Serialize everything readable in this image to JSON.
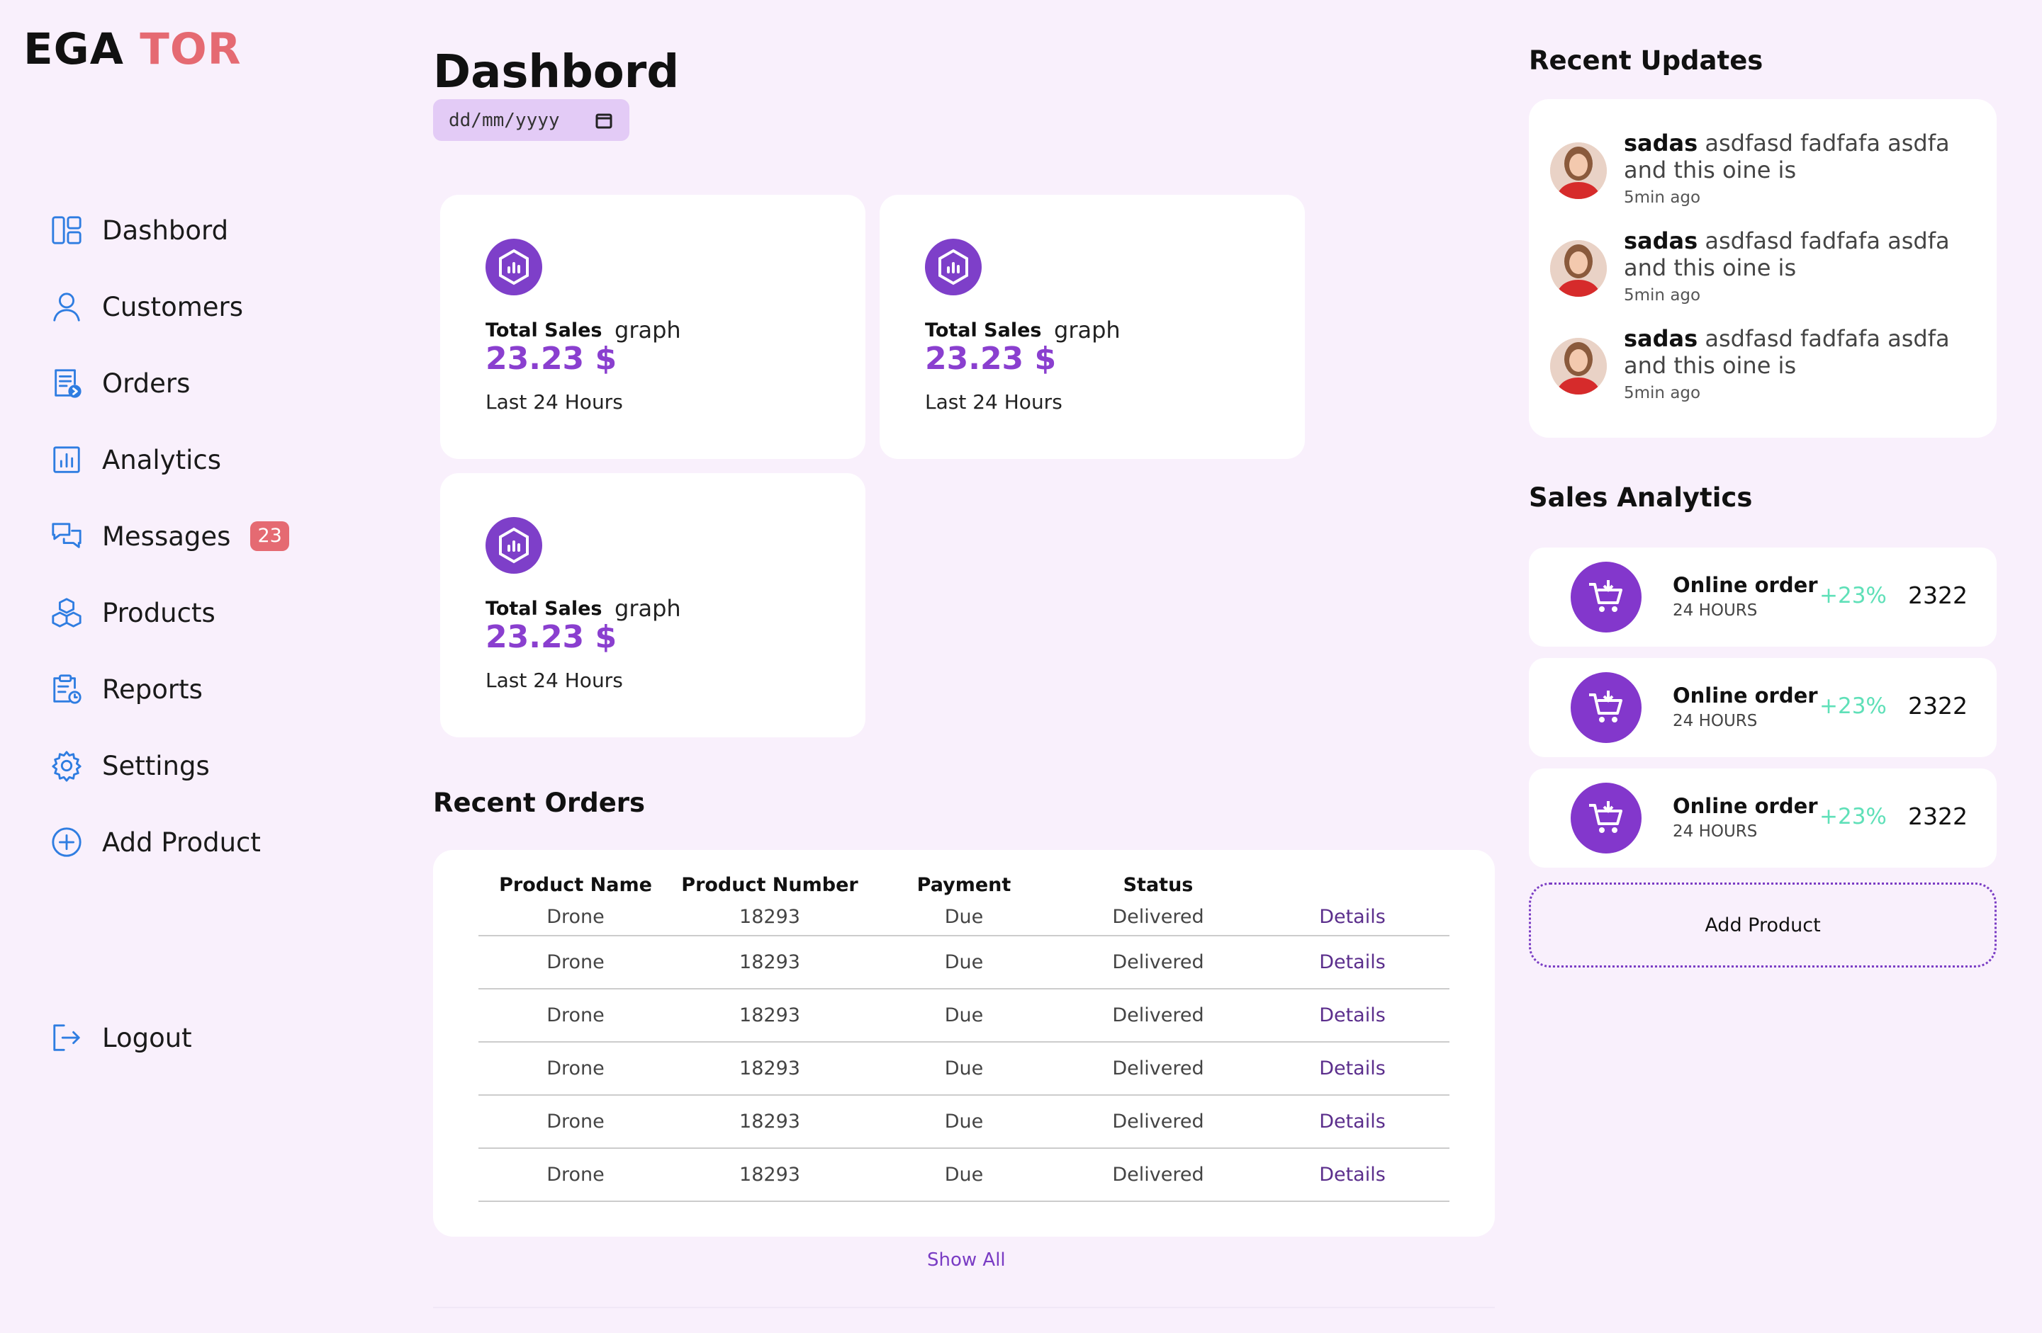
{
  "logo": {
    "part1": "EGA",
    "part2": "TOR"
  },
  "sidebar": {
    "items": [
      {
        "label": "Dashbord",
        "icon": "dashboard-icon"
      },
      {
        "label": "Customers",
        "icon": "user-icon"
      },
      {
        "label": "Orders",
        "icon": "orders-icon"
      },
      {
        "label": "Analytics",
        "icon": "analytics-icon"
      },
      {
        "label": "Messages",
        "icon": "messages-icon",
        "badge": "23"
      },
      {
        "label": "Products",
        "icon": "boxes-icon"
      },
      {
        "label": "Reports",
        "icon": "reports-icon"
      },
      {
        "label": "Settings",
        "icon": "gear-icon"
      },
      {
        "label": "Add Product",
        "icon": "plus-circle-icon"
      }
    ],
    "logout": {
      "label": "Logout",
      "icon": "logout-icon"
    }
  },
  "main": {
    "title": "Dashbord",
    "date_placeholder": "dd/mm/yyyy",
    "cards": [
      {
        "title": "Total Sales",
        "graph": "graph",
        "amount": "23.23 $",
        "period": "Last 24 Hours"
      },
      {
        "title": "Total Sales",
        "graph": "graph",
        "amount": "23.23 $",
        "period": "Last 24 Hours"
      },
      {
        "title": "Total Sales",
        "graph": "graph",
        "amount": "23.23 $",
        "period": "Last 24 Hours"
      }
    ],
    "orders": {
      "title": "Recent Orders",
      "headers": [
        "Product Name",
        "Product Number",
        "Payment",
        "Status"
      ],
      "rows": [
        {
          "name": "Drone",
          "number": "18293",
          "payment": "Due",
          "status": "Delivered",
          "action": "Details"
        },
        {
          "name": "Drone",
          "number": "18293",
          "payment": "Due",
          "status": "Delivered",
          "action": "Details"
        },
        {
          "name": "Drone",
          "number": "18293",
          "payment": "Due",
          "status": "Delivered",
          "action": "Details"
        },
        {
          "name": "Drone",
          "number": "18293",
          "payment": "Due",
          "status": "Delivered",
          "action": "Details"
        },
        {
          "name": "Drone",
          "number": "18293",
          "payment": "Due",
          "status": "Delivered",
          "action": "Details"
        },
        {
          "name": "Drone",
          "number": "18293",
          "payment": "Due",
          "status": "Delivered",
          "action": "Details"
        }
      ],
      "show_all": "Show All"
    }
  },
  "right": {
    "updates_title": "Recent Updates",
    "updates": [
      {
        "name": "sadas",
        "text": "asdfasd fadfafa asdfa and this oine is",
        "time": "5min ago"
      },
      {
        "name": "sadas",
        "text": "asdfasd fadfafa asdfa and this oine is",
        "time": "5min ago"
      },
      {
        "name": "sadas",
        "text": "asdfasd fadfafa asdfa and this oine is",
        "time": "5min ago"
      }
    ],
    "analytics_title": "Sales Analytics",
    "analytics": [
      {
        "title": "Online order",
        "sub": "24 HOURS",
        "pct": "+23%",
        "value": "2322"
      },
      {
        "title": "Online order",
        "sub": "24 HOURS",
        "pct": "+23%",
        "value": "2322"
      },
      {
        "title": "Online order",
        "sub": "24 HOURS",
        "pct": "+23%",
        "value": "2322"
      }
    ],
    "add_product": "Add Product"
  },
  "colors": {
    "accent": "#8337cc",
    "logo_accent": "#e56a72",
    "nav_icon": "#2f7de1",
    "positive": "#5fe0b8",
    "background": "#f9f0fc"
  }
}
